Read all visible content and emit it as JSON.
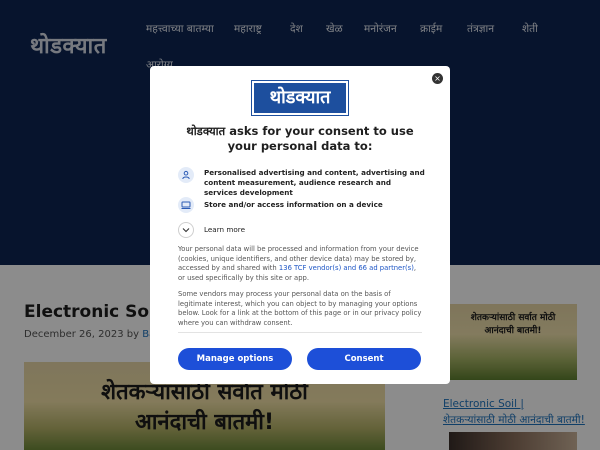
{
  "site": {
    "logo": "थोडक्यात",
    "nav": [
      "महत्त्वाच्या बातम्या",
      "महाराष्ट्र",
      "देश",
      "खेळ",
      "मनोरंजन",
      "क्राईम",
      "तंत्रज्ञान",
      "शेती",
      "आरोग्य"
    ]
  },
  "article": {
    "title": "Electronic Soi",
    "date": "December 26, 2023",
    "by": "by",
    "author": "Babl",
    "hero_line1": "शेतकऱ्यांसाठी सर्वात मोठी",
    "hero_line2": "आनंदाची बातमी!"
  },
  "sidebar": {
    "image_line1": "शेतकऱ्यांसाठी सर्वात मोठी",
    "image_line2": "आनंदाची बातमी!",
    "link_line1": "Electronic Soil |",
    "link_line2": "शेतकऱ्यांसाठी मोठी आनंदाची बातमी!"
  },
  "consent": {
    "logo": "थोडक्यात",
    "close": "×",
    "title_site": "थोडक्यात",
    "title_rest": "asks for your consent to use your personal data to:",
    "purposes": [
      {
        "icon": "person-icon",
        "text": "Personalised advertising and content, advertising and content measurement, audience research and services development"
      },
      {
        "icon": "device-icon",
        "text": "Store and/or access information on a device"
      }
    ],
    "learn_more": "Learn more",
    "para1_a": "Your personal data will be processed and information from your device (cookies, unique identifiers, and other device data) may be stored by, accessed by and shared with",
    "para1_link": "136 TCF vendor(s) and 66 ad partner(s)",
    "para1_b": ", or used specifically by this site or app.",
    "para2": "Some vendors may process your personal data on the basis of legitimate interest, which you can object to by managing your options below. Look for a link at the bottom of this page or in our privacy policy where you can withdraw consent.",
    "manage_label": "Manage options",
    "consent_label": "Consent"
  },
  "colors": {
    "header_bg": "#0d2552",
    "button_bg": "#1d4fd8",
    "link": "#1e73be"
  }
}
